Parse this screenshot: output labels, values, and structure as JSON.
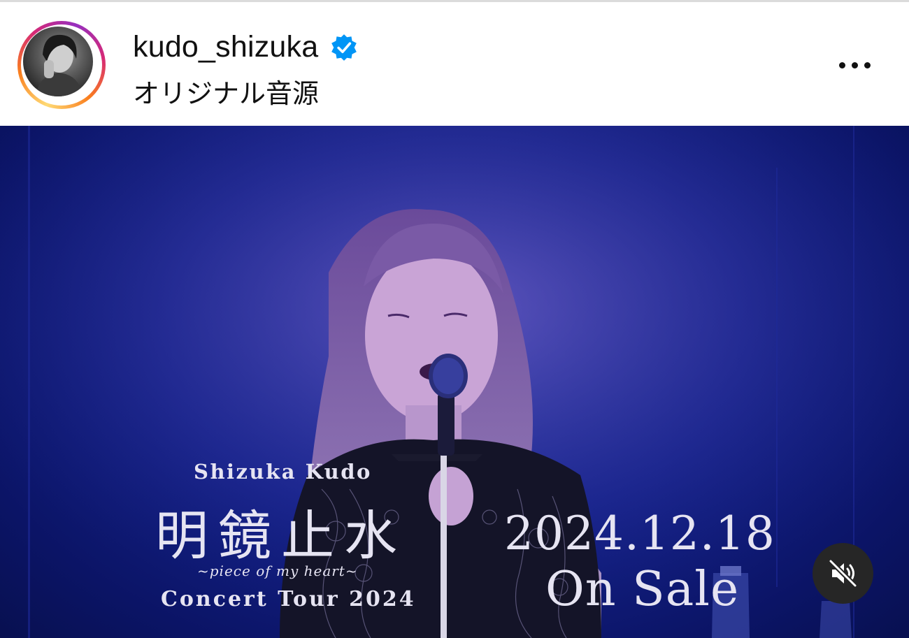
{
  "post": {
    "username": "kudo_shizuka",
    "verified": true,
    "audio_label": "オリジナル音源",
    "more_icon": "more-horizontal-icon"
  },
  "video": {
    "overlay": {
      "artist": "Shizuka Kudo",
      "album_title": "明鏡止水",
      "album_subtitle": "~piece of my heart~",
      "tour_name": "Concert Tour 2024",
      "release_date": "2024.12.18",
      "release_status": "On Sale"
    },
    "muted": true,
    "mute_icon": "speaker-muted-icon"
  },
  "colors": {
    "stage_blue": "#15228a",
    "verified_badge": "#0095f6",
    "mute_button_bg": "#262626"
  }
}
